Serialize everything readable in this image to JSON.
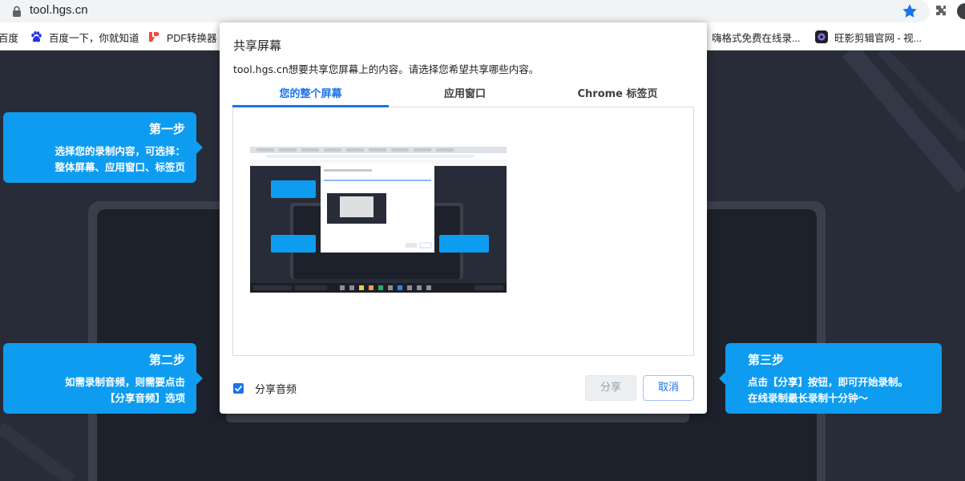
{
  "browser": {
    "url": "tool.hgs.cn",
    "bookmarks": [
      {
        "label": "百度",
        "icon": "page-icon"
      },
      {
        "label": "百度一下，你就知道",
        "icon": "baidu-paw-icon"
      },
      {
        "label": "PDF转换器",
        "icon": "pdf-logo-icon"
      },
      {
        "label": "嗨格式免费在线录...",
        "icon": "page-icon"
      },
      {
        "label": "旺影剪辑官网 - 视...",
        "icon": "wangying-logo-icon"
      }
    ]
  },
  "dialog": {
    "title": "共享屏幕",
    "description": "tool.hgs.cn想要共享您屏幕上的内容。请选择您希望共享哪些内容。",
    "tabs": [
      {
        "label": "您的整个屏幕",
        "active": true
      },
      {
        "label": "应用窗口",
        "active": false
      },
      {
        "label": "Chrome 标签页",
        "active": false
      }
    ],
    "share_audio_label": "分享音频",
    "share_audio_checked": true,
    "share_button": "分享",
    "cancel_button": "取消"
  },
  "callouts": {
    "step1": {
      "title": "第一步",
      "lines": [
        "选择您的录制内容，可选择：",
        "整体屏幕、应用窗口、标签页"
      ]
    },
    "step2": {
      "title": "第二步",
      "lines": [
        "如需录制音频，则需要点击",
        "【分享音频】选项"
      ]
    },
    "step3": {
      "title": "第三步",
      "lines": [
        "点击【分享】按钮，即可开始录制。",
        "在线录制最长录制十分钟～"
      ]
    }
  },
  "colors": {
    "accent": "#1a73e8",
    "callout": "#0e9cf0",
    "page_bg": "#272c38"
  }
}
